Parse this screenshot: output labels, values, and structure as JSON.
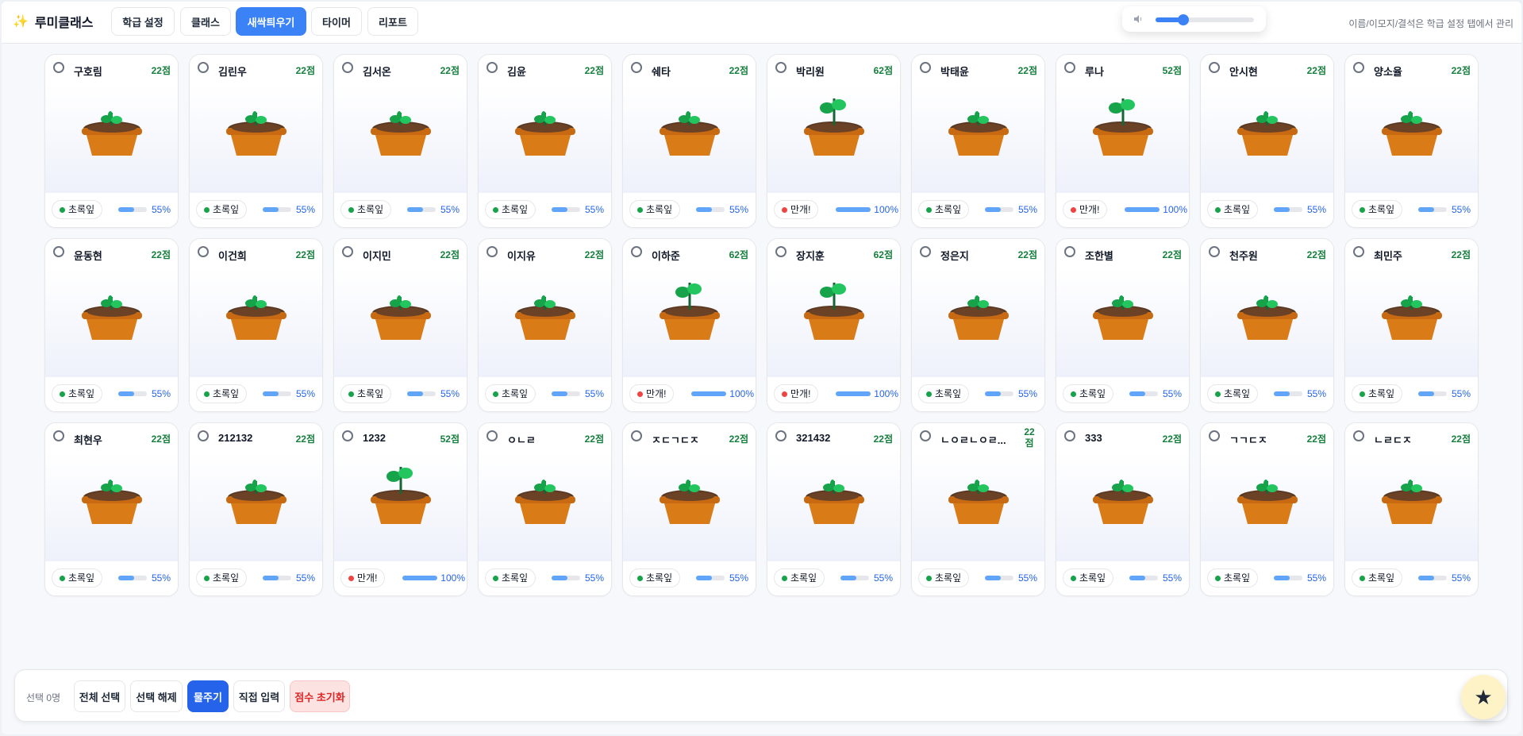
{
  "header": {
    "brand_icon": "sparkles-icon",
    "brand_name": "루미클래스",
    "tabs": [
      {
        "label": "학급 설정",
        "active": false
      },
      {
        "label": "클래스",
        "active": false
      },
      {
        "label": "새싹틔우기",
        "active": true
      },
      {
        "label": "타이머",
        "active": false
      },
      {
        "label": "리포트",
        "active": false
      }
    ],
    "volume": {
      "icon": "speaker-icon",
      "level": 0.28
    },
    "hint": "이름/이모지/결석은 학급 설정 탭에서 관리"
  },
  "colors": {
    "accent": "#3b82f6",
    "leaf_stage": "#16a34a",
    "bloom_stage": "#ef4444",
    "score": "#15803d"
  },
  "students": [
    {
      "name": "구호림",
      "score": "22점",
      "stage": "초록잎",
      "progress": "55%",
      "bloom": false
    },
    {
      "name": "김린우",
      "score": "22점",
      "stage": "초록잎",
      "progress": "55%",
      "bloom": false
    },
    {
      "name": "김서온",
      "score": "22점",
      "stage": "초록잎",
      "progress": "55%",
      "bloom": false
    },
    {
      "name": "김윤",
      "score": "22점",
      "stage": "초록잎",
      "progress": "55%",
      "bloom": false
    },
    {
      "name": "쉐타",
      "score": "22점",
      "stage": "초록잎",
      "progress": "55%",
      "bloom": false
    },
    {
      "name": "박리원",
      "score": "62점",
      "stage": "만개!",
      "progress": "100%",
      "bloom": true
    },
    {
      "name": "박태윤",
      "score": "22점",
      "stage": "초록잎",
      "progress": "55%",
      "bloom": false
    },
    {
      "name": "루나",
      "score": "52점",
      "stage": "만개!",
      "progress": "100%",
      "bloom": true
    },
    {
      "name": "안시현",
      "score": "22점",
      "stage": "초록잎",
      "progress": "55%",
      "bloom": false
    },
    {
      "name": "양소율",
      "score": "22점",
      "stage": "초록잎",
      "progress": "55%",
      "bloom": false
    },
    {
      "name": "윤동현",
      "score": "22점",
      "stage": "초록잎",
      "progress": "55%",
      "bloom": false
    },
    {
      "name": "이건희",
      "score": "22점",
      "stage": "초록잎",
      "progress": "55%",
      "bloom": false
    },
    {
      "name": "이지민",
      "score": "22점",
      "stage": "초록잎",
      "progress": "55%",
      "bloom": false
    },
    {
      "name": "이지유",
      "score": "22점",
      "stage": "초록잎",
      "progress": "55%",
      "bloom": false
    },
    {
      "name": "이하준",
      "score": "62점",
      "stage": "만개!",
      "progress": "100%",
      "bloom": true
    },
    {
      "name": "장지훈",
      "score": "62점",
      "stage": "만개!",
      "progress": "100%",
      "bloom": true
    },
    {
      "name": "정은지",
      "score": "22점",
      "stage": "초록잎",
      "progress": "55%",
      "bloom": false
    },
    {
      "name": "조한별",
      "score": "22점",
      "stage": "초록잎",
      "progress": "55%",
      "bloom": false
    },
    {
      "name": "천주원",
      "score": "22점",
      "stage": "초록잎",
      "progress": "55%",
      "bloom": false
    },
    {
      "name": "최민주",
      "score": "22점",
      "stage": "초록잎",
      "progress": "55%",
      "bloom": false
    },
    {
      "name": "최현우",
      "score": "22점",
      "stage": "초록잎",
      "progress": "55%",
      "bloom": false
    },
    {
      "name": "212132",
      "score": "22점",
      "stage": "초록잎",
      "progress": "55%",
      "bloom": false
    },
    {
      "name": "1232",
      "score": "52점",
      "stage": "만개!",
      "progress": "100%",
      "bloom": true
    },
    {
      "name": "ㅇㄴㄹ",
      "score": "22점",
      "stage": "초록잎",
      "progress": "55%",
      "bloom": false
    },
    {
      "name": "ㅈㄷㄱㄷㅈ",
      "score": "22점",
      "stage": "초록잎",
      "progress": "55%",
      "bloom": false
    },
    {
      "name": "321432",
      "score": "22점",
      "stage": "초록잎",
      "progress": "55%",
      "bloom": false
    },
    {
      "name": "ㄴㅇㄹㄴㅇㄹ...",
      "score": "22점",
      "stage": "초록잎",
      "progress": "55%",
      "bloom": false
    },
    {
      "name": "333",
      "score": "22점",
      "stage": "초록잎",
      "progress": "55%",
      "bloom": false
    },
    {
      "name": "ㄱㄱㄷㅈ",
      "score": "22점",
      "stage": "초록잎",
      "progress": "55%",
      "bloom": false
    },
    {
      "name": "ㄴㄹㄷㅈ",
      "score": "22점",
      "stage": "초록잎",
      "progress": "55%",
      "bloom": false
    }
  ],
  "footer": {
    "selected_count": "선택 0명",
    "select_all": "전체 선택",
    "deselect": "선택 해제",
    "water": "물주기",
    "direct_input": "직접 입력",
    "reset_scores": "점수 초기화",
    "fab_icon": "star-icon",
    "fab_glyph": "★"
  }
}
